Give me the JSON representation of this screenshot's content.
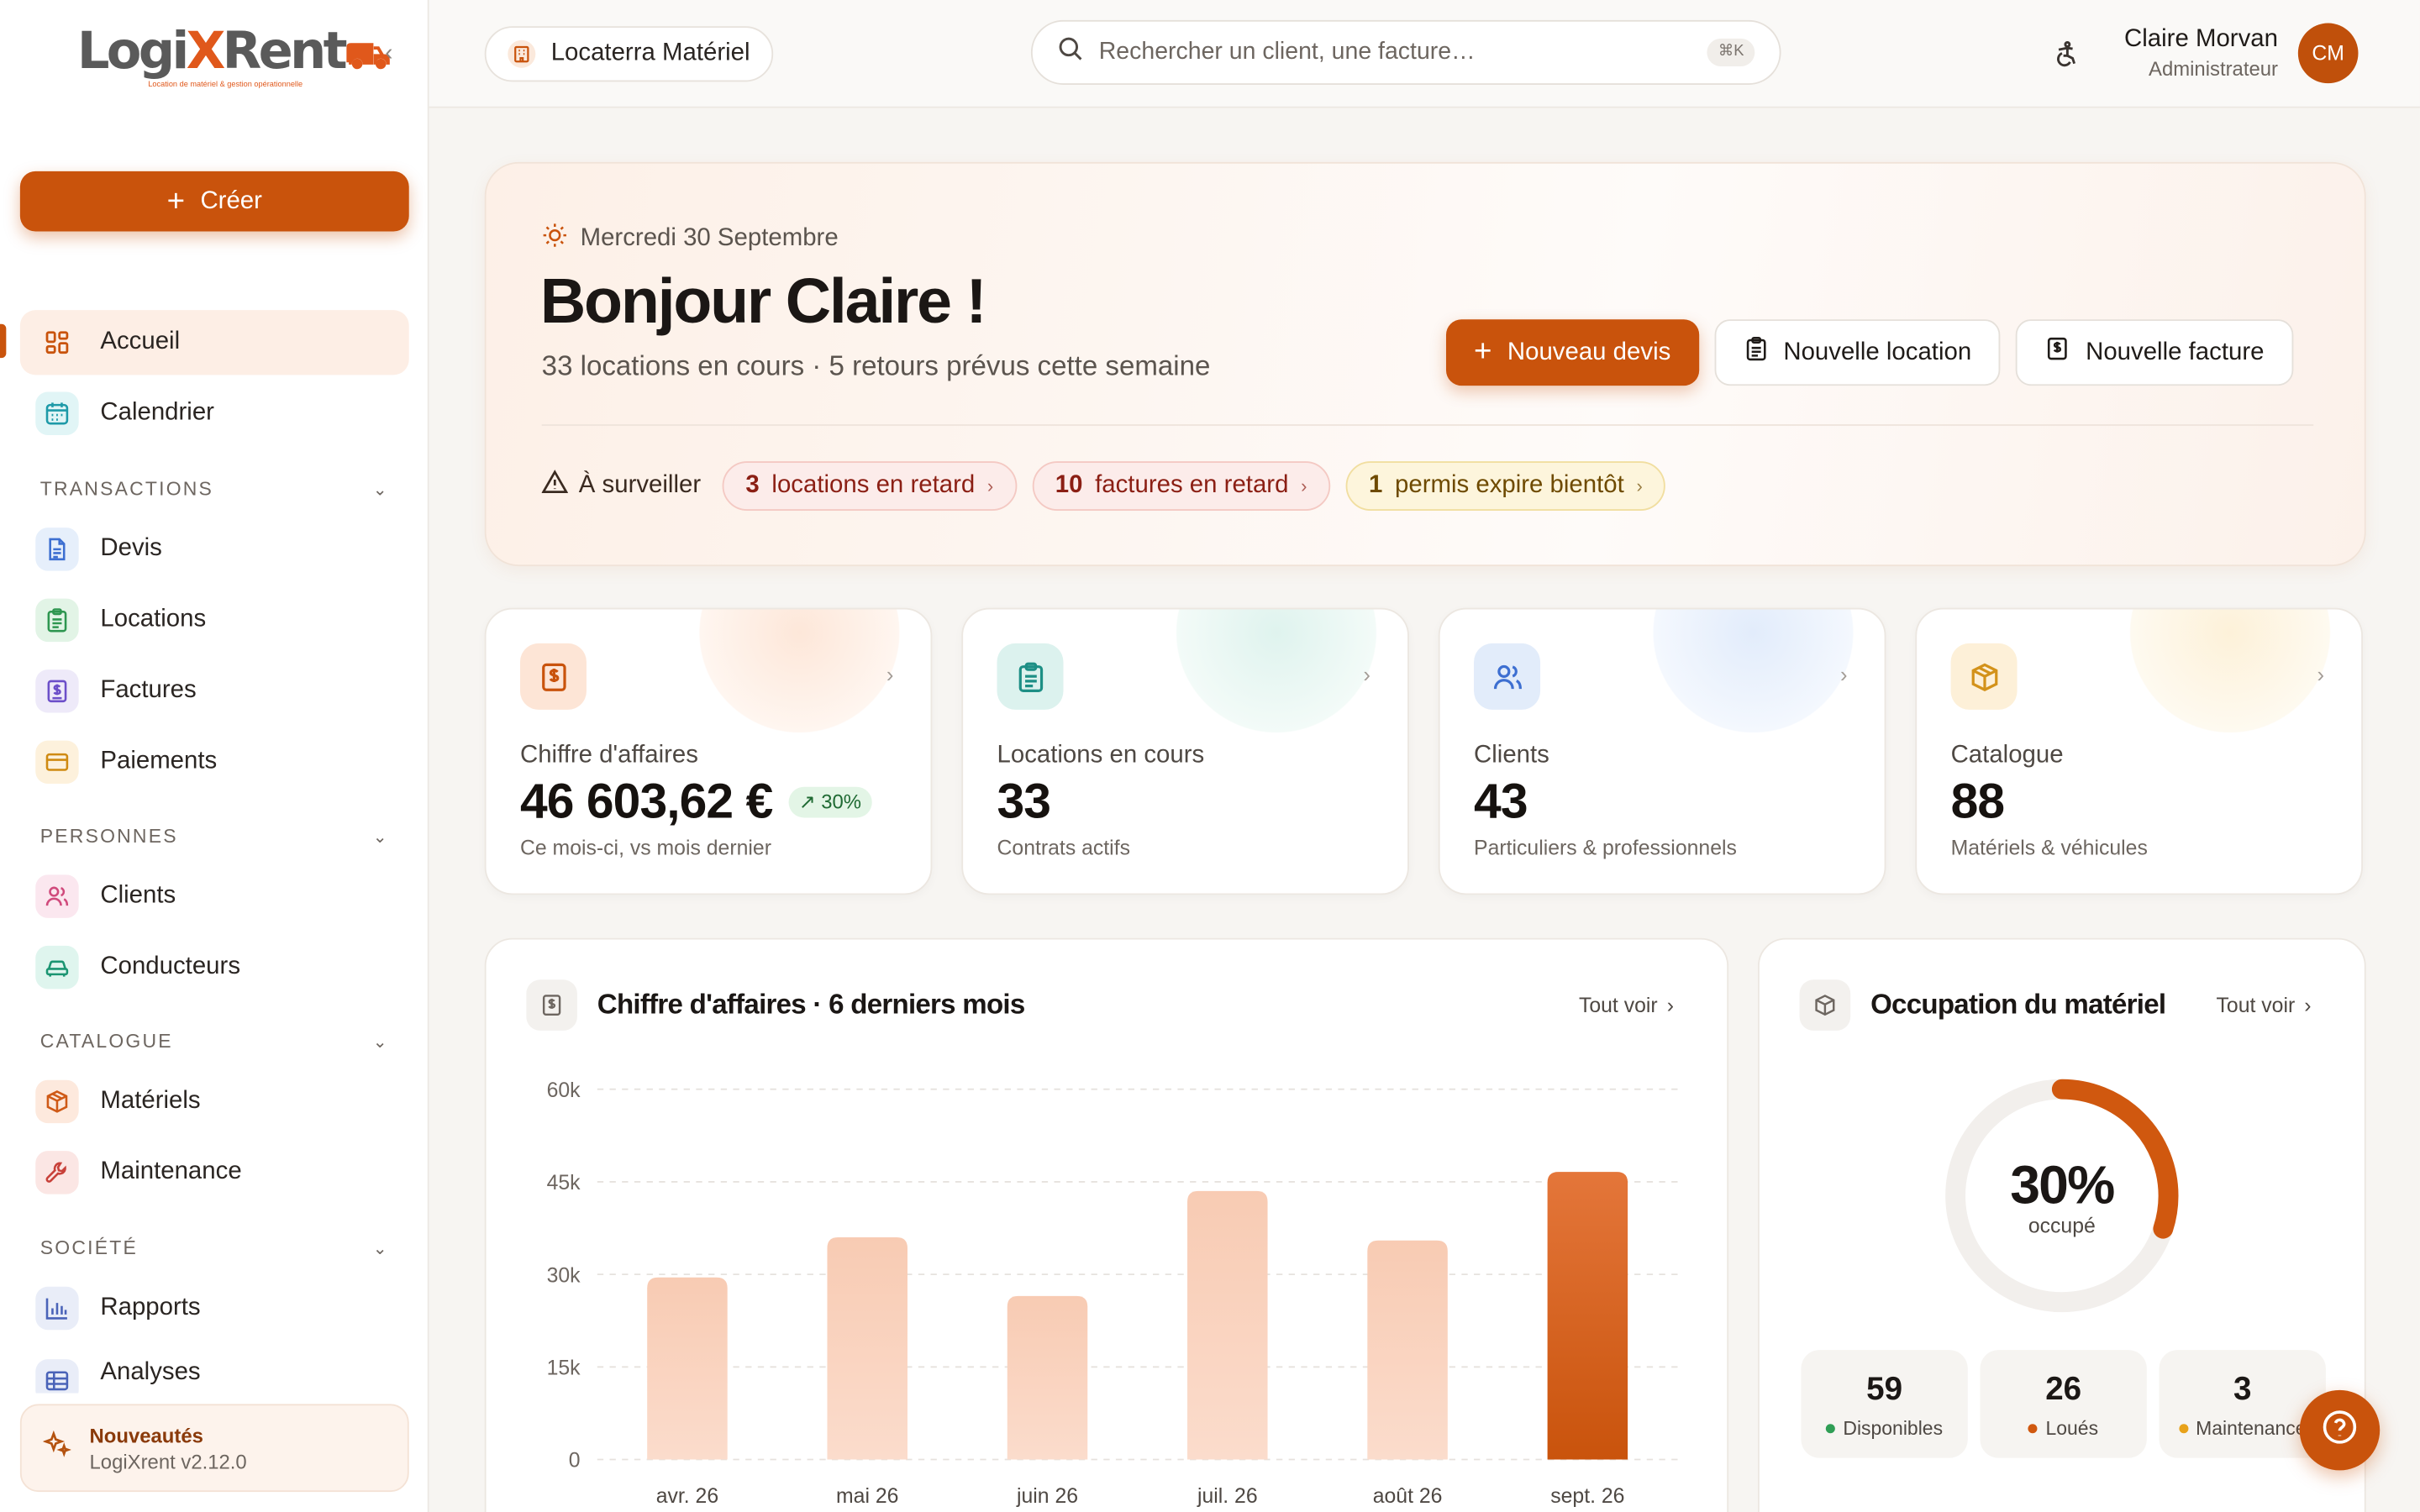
{
  "app": {
    "logo_main": "Logi",
    "logo_x": "X",
    "logo_rest": "Rent",
    "logo_tagline": "Location de matériel & gestion opérationnelle",
    "accent": "#c9530c"
  },
  "sidebar": {
    "create_label": "Créer",
    "items": [
      {
        "label": "Accueil",
        "icon": "grid-icon"
      },
      {
        "label": "Calendrier",
        "icon": "calendar-icon"
      },
      {
        "label": "Devis",
        "icon": "document-icon"
      },
      {
        "label": "Locations",
        "icon": "clipboard-icon"
      },
      {
        "label": "Factures",
        "icon": "invoice-icon"
      },
      {
        "label": "Paiements",
        "icon": "card-icon"
      },
      {
        "label": "Clients",
        "icon": "users-icon"
      },
      {
        "label": "Conducteurs",
        "icon": "car-icon"
      },
      {
        "label": "Matériels",
        "icon": "box-icon"
      },
      {
        "label": "Maintenance",
        "icon": "wrench-icon"
      },
      {
        "label": "Rapports",
        "icon": "bar-chart-icon"
      },
      {
        "label": "Analyses",
        "icon": "table-icon"
      }
    ],
    "sections": [
      "TRANSACTIONS",
      "PERSONNES",
      "CATALOGUE",
      "SOCIÉTÉ"
    ],
    "news_title": "Nouveautés",
    "news_version": "LogiXrent v2.12.0"
  },
  "header": {
    "org_name": "Locaterra Matériel",
    "search_placeholder": "Rechercher un client, une facture…",
    "search_shortcut": "⌘K",
    "user_name": "Claire Morvan",
    "user_role": "Administrateur",
    "user_initials": "CM"
  },
  "hero": {
    "date": "Mercredi 30 Septembre",
    "greeting": "Bonjour Claire !",
    "summary": "33 locations en cours · 5 retours prévus cette semaine",
    "actions": [
      "Nouveau devis",
      "Nouvelle location",
      "Nouvelle facture"
    ],
    "watch_label": "À surveiller",
    "alerts": [
      {
        "count": "3",
        "text": "locations en retard"
      },
      {
        "count": "10",
        "text": "factures en retard"
      },
      {
        "count": "1",
        "text": "permis expire bientôt"
      }
    ]
  },
  "stats": [
    {
      "label": "Chiffre d'affaires",
      "value": "46 603,62 €",
      "trend": "↗ 30%",
      "sub": "Ce mois-ci, vs mois dernier"
    },
    {
      "label": "Locations en cours",
      "value": "33",
      "sub": "Contrats actifs"
    },
    {
      "label": "Clients",
      "value": "43",
      "sub": "Particuliers & professionnels"
    },
    {
      "label": "Catalogue",
      "value": "88",
      "sub": "Matériels & véhicules"
    }
  ],
  "revenue_panel": {
    "title": "Chiffre d'affaires · 6 derniers mois",
    "link": "Tout voir"
  },
  "chart_data": {
    "type": "bar",
    "title": "Chiffre d'affaires · 6 derniers mois",
    "categories": [
      "avr. 26",
      "mai 26",
      "juin 26",
      "juil. 26",
      "août 26",
      "sept. 26"
    ],
    "values": [
      29500,
      36000,
      26500,
      43500,
      35500,
      46600
    ],
    "ylim": [
      0,
      60000
    ],
    "yticks": [
      0,
      15000,
      30000,
      45000,
      60000
    ],
    "ytick_labels": [
      "0",
      "15k",
      "30k",
      "45k",
      "60k"
    ],
    "grid": true,
    "colors": {
      "bar": "#f8cbb3",
      "highlight": "#c9530c"
    }
  },
  "occupation_panel": {
    "title": "Occupation du matériel",
    "link": "Tout voir",
    "percent_label": "30%",
    "percent": 30,
    "caption": "occupé",
    "stats": [
      {
        "value": "59",
        "label": "Disponibles",
        "color": "#2f9e55"
      },
      {
        "value": "26",
        "label": "Loués",
        "color": "#d0580f"
      },
      {
        "value": "3",
        "label": "Maintenance",
        "color": "#e8a21a"
      }
    ]
  }
}
